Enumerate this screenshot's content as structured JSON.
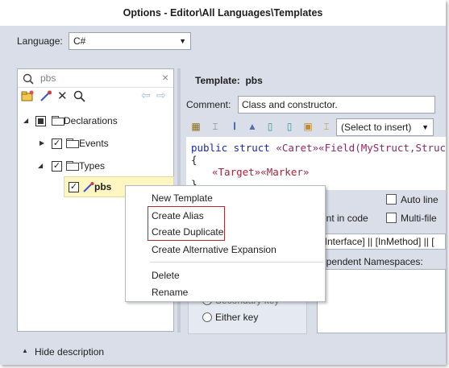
{
  "window": {
    "title": "Options - Editor\\All Languages\\Templates"
  },
  "language": {
    "label": "Language:",
    "value": "C#"
  },
  "search": {
    "value": "pbs",
    "clear": "×"
  },
  "tree": {
    "root": "Declarations",
    "events": "Events",
    "types": "Types",
    "selected": "pbs"
  },
  "editor": {
    "template_label": "Template:",
    "template_name": "pbs",
    "comment_label": "Comment:",
    "comment_value": "Class and constructor.",
    "insert_select": "(Select to insert)",
    "code_line1_a": "public struct ",
    "code_line1_b": "«Caret»«Field(MyStruct,Struct",
    "code_line2": "{",
    "code_line3": "«Target»«Marker»",
    "code_line4": "}",
    "auto_line": "Auto line",
    "in_code": "ent in code",
    "multi_file": "Multi-file",
    "scope_text": "nInterface] || [InMethod] || [",
    "dep_ns": "ependent Namespaces:",
    "secondary_key": "Secondary key",
    "either_key": "Either key"
  },
  "context_menu": {
    "items": [
      "New Template",
      "Create Alias",
      "Create Duplicate",
      "Create Alternative Expansion",
      "Delete",
      "Rename"
    ]
  },
  "footer": {
    "hide_description": "Hide description"
  },
  "colors": {
    "keyword": "#1a27b0",
    "field": "#8b2a62",
    "target": "#a8233b",
    "highlight": "#fff6c4",
    "redbox": "#b02a30"
  }
}
